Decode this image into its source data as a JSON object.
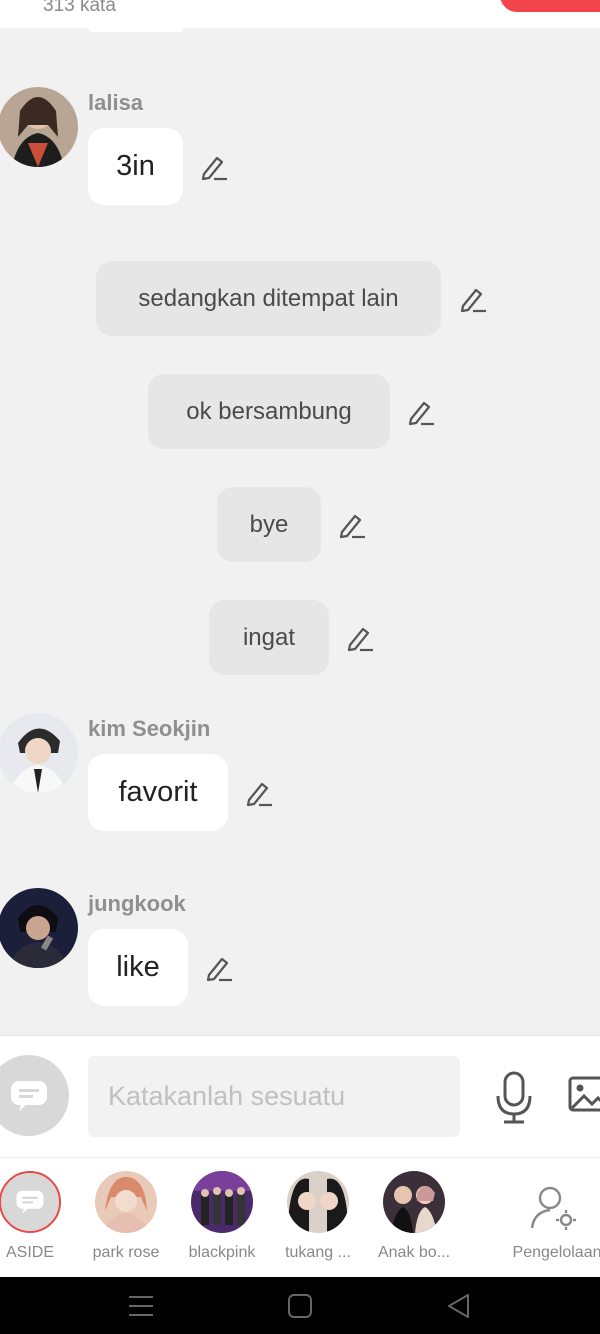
{
  "header": {
    "word_count": "313 kata"
  },
  "messages": [
    {
      "type": "character",
      "name": "lalisa",
      "text": "3in"
    },
    {
      "type": "narration",
      "text": "sedangkan ditempat lain"
    },
    {
      "type": "narration",
      "text": "ok bersambung"
    },
    {
      "type": "narration",
      "text": "bye"
    },
    {
      "type": "narration",
      "text": "ingat"
    },
    {
      "type": "character",
      "name": "kim Seokjin",
      "text": "favorit"
    },
    {
      "type": "character",
      "name": "jungkook",
      "text": "like"
    }
  ],
  "composer": {
    "placeholder": "Katakanlah sesuatu"
  },
  "characters": [
    {
      "label": "ASIDE"
    },
    {
      "label": "park rose"
    },
    {
      "label": "blackpink"
    },
    {
      "label": "tukang ..."
    },
    {
      "label": "Anak bo..."
    },
    {
      "label": "Pengelolaan"
    }
  ],
  "colors": {
    "accent": "#f2444a",
    "background": "#f1f1f1",
    "bubble": "#ffffff",
    "narration": "#e6e6e6"
  }
}
